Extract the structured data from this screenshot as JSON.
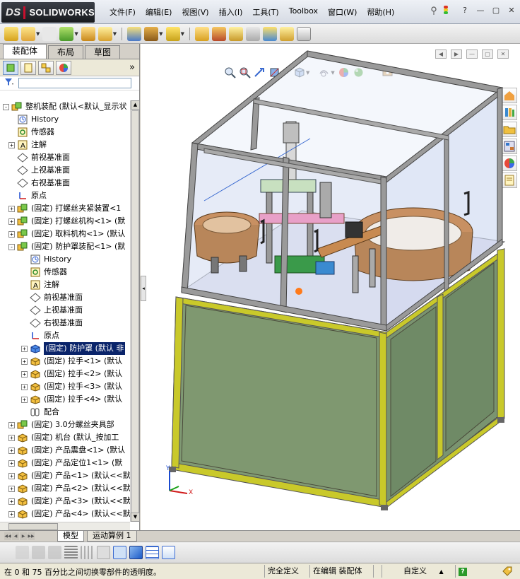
{
  "app": {
    "logo_prefix": "DS",
    "logo_text": "SOLIDWORKS"
  },
  "menu": [
    "文件(F)",
    "编辑(E)",
    "视图(V)",
    "插入(I)",
    "工具(T)",
    "Toolbox",
    "窗口(W)",
    "帮助(H)"
  ],
  "window_controls": {
    "help": "?",
    "minimize": "—",
    "restore": "▢",
    "close": "✕"
  },
  "panel_tabs": [
    "装配体",
    "布局",
    "草图"
  ],
  "panel_more": "»",
  "tree": [
    {
      "level": 0,
      "exp": "-",
      "icon": "assembly",
      "label": "整机装配  (默认<默认_显示状"
    },
    {
      "level": 1,
      "exp": "",
      "icon": "history",
      "label": "History"
    },
    {
      "level": 1,
      "exp": "",
      "icon": "sensor",
      "label": "传感器"
    },
    {
      "level": 1,
      "exp": "+",
      "icon": "annotation",
      "label": "注解"
    },
    {
      "level": 1,
      "exp": "",
      "icon": "plane",
      "label": "前视基准面"
    },
    {
      "level": 1,
      "exp": "",
      "icon": "plane",
      "label": "上视基准面"
    },
    {
      "level": 1,
      "exp": "",
      "icon": "plane",
      "label": "右视基准面"
    },
    {
      "level": 1,
      "exp": "",
      "icon": "origin",
      "label": "原点"
    },
    {
      "level": 1,
      "exp": "+",
      "icon": "assembly",
      "label": "(固定) 打螺丝夹紧装置<1"
    },
    {
      "level": 1,
      "exp": "+",
      "icon": "assembly",
      "label": "(固定) 打螺丝机构<1> (默"
    },
    {
      "level": 1,
      "exp": "+",
      "icon": "assembly",
      "label": "(固定) 取料机构<1> (默认"
    },
    {
      "level": 1,
      "exp": "-",
      "icon": "assembly",
      "label": "(固定) 防护罩装配<1> (默"
    },
    {
      "level": 2,
      "exp": "",
      "icon": "history",
      "label": "History"
    },
    {
      "level": 2,
      "exp": "",
      "icon": "sensor",
      "label": "传感器"
    },
    {
      "level": 2,
      "exp": "",
      "icon": "annotation",
      "label": "注解"
    },
    {
      "level": 2,
      "exp": "",
      "icon": "plane",
      "label": "前视基准面"
    },
    {
      "level": 2,
      "exp": "",
      "icon": "plane",
      "label": "上视基准面"
    },
    {
      "level": 2,
      "exp": "",
      "icon": "plane",
      "label": "右视基准面"
    },
    {
      "level": 2,
      "exp": "",
      "icon": "origin",
      "label": "原点"
    },
    {
      "level": 2,
      "exp": "+",
      "icon": "part-blue",
      "label": "(固定) 防护罩 (默认 非",
      "selected": true
    },
    {
      "level": 2,
      "exp": "+",
      "icon": "part",
      "label": "(固定) 拉手<1> (默认"
    },
    {
      "level": 2,
      "exp": "+",
      "icon": "part",
      "label": "(固定) 拉手<2> (默认"
    },
    {
      "level": 2,
      "exp": "+",
      "icon": "part",
      "label": "(固定) 拉手<3> (默认"
    },
    {
      "level": 2,
      "exp": "+",
      "icon": "part",
      "label": "(固定) 拉手<4> (默认"
    },
    {
      "level": 2,
      "exp": "",
      "icon": "mate",
      "label": "配合"
    },
    {
      "level": 1,
      "exp": "+",
      "icon": "assembly",
      "label": "(固定) 3.0分螺丝夹具部"
    },
    {
      "level": 1,
      "exp": "+",
      "icon": "part",
      "label": "(固定) 机台 (默认_按加工"
    },
    {
      "level": 1,
      "exp": "+",
      "icon": "part",
      "label": "(固定) 产品震盘<1> (默认"
    },
    {
      "level": 1,
      "exp": "+",
      "icon": "part",
      "label": "(固定) 产品定位1<1> (默"
    },
    {
      "level": 1,
      "exp": "+",
      "icon": "part",
      "label": "(固定) 产品<1> (默认<<默"
    },
    {
      "level": 1,
      "exp": "+",
      "icon": "part",
      "label": "(固定) 产品<2> (默认<<默"
    },
    {
      "level": 1,
      "exp": "+",
      "icon": "part",
      "label": "(固定) 产品<3> (默认<<默"
    },
    {
      "level": 1,
      "exp": "+",
      "icon": "part",
      "label": "(固定) 产品<4> (默认<<默"
    }
  ],
  "bottom_tabs": [
    "模型",
    "运动算例 1"
  ],
  "status": {
    "message": "在 0 和 75 百分比之间切换零部件的透明度。",
    "definition": "完全定义",
    "editing": "在编辑 装配体",
    "units": "自定义",
    "units_arrow": "▲",
    "help_badge": "?"
  },
  "triad": {
    "x": "X",
    "y": "Y",
    "z": "Z"
  },
  "colors": {
    "frame": "#9a9a9a",
    "glass": "#c8d4f0",
    "panel_green": "#7f9870",
    "base_frame": "#c9c92a",
    "bowl": "#b8865a",
    "selection": "#0a246a"
  }
}
